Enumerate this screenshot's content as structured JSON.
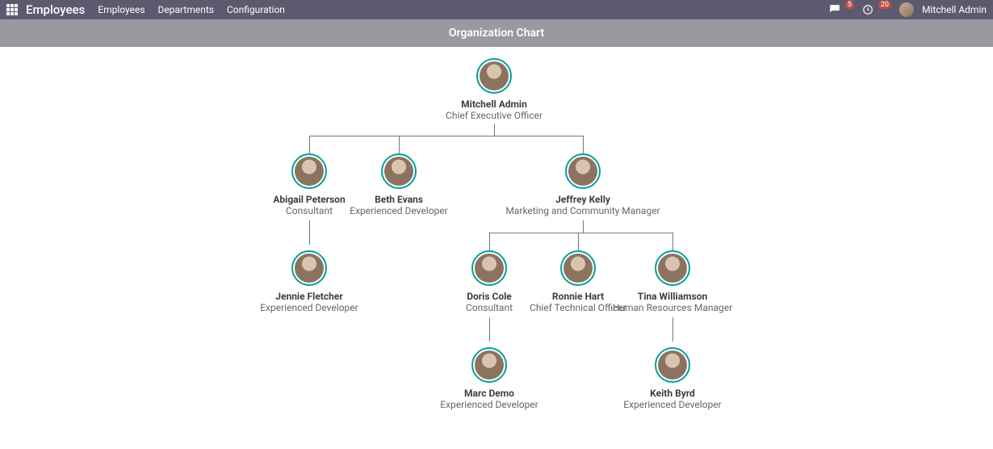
{
  "topbar": {
    "brand": "Employees",
    "nav": [
      "Employees",
      "Departments",
      "Configuration"
    ],
    "messages_badge": "5",
    "clock_badge": "20",
    "user_name": "Mitchell Admin"
  },
  "subheader": {
    "title": "Organization Chart"
  },
  "org": {
    "root": {
      "name": "Mitchell Admin",
      "role": "Chief Executive Officer"
    },
    "abigail": {
      "name": "Abigail Peterson",
      "role": "Consultant"
    },
    "beth": {
      "name": "Beth Evans",
      "role": "Experienced Developer"
    },
    "jeffrey": {
      "name": "Jeffrey Kelly",
      "role": "Marketing and Community Manager"
    },
    "jennie": {
      "name": "Jennie Fletcher",
      "role": "Experienced Developer"
    },
    "doris": {
      "name": "Doris Cole",
      "role": "Consultant"
    },
    "ronnie": {
      "name": "Ronnie Hart",
      "role": "Chief Technical Officer"
    },
    "tina": {
      "name": "Tina Williamson",
      "role": "Human Resources Manager"
    },
    "marc": {
      "name": "Marc Demo",
      "role": "Experienced Developer"
    },
    "keith": {
      "name": "Keith Byrd",
      "role": "Experienced Developer"
    }
  }
}
